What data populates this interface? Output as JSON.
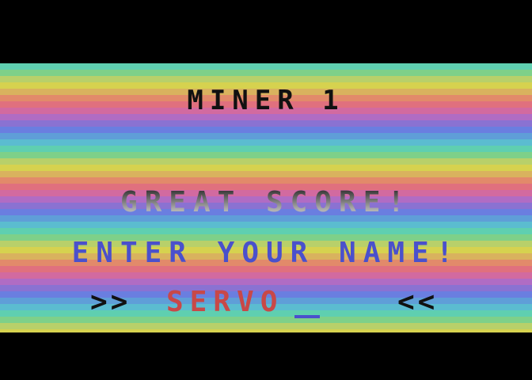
{
  "game": {
    "title": "MINER 1",
    "message": "GREAT SCORE!",
    "prompt": "ENTER YOUR NAME!",
    "left_marker": ">>",
    "right_marker": "<<",
    "name_value": "SERVO"
  },
  "colors": {
    "background": "#000000",
    "title": "#111111",
    "prompt": "#4a50cc",
    "name": "#c84848",
    "cursor": "#4a50cc",
    "message_gradient": [
      "#2c2c2c",
      "#d0d0d0"
    ]
  }
}
